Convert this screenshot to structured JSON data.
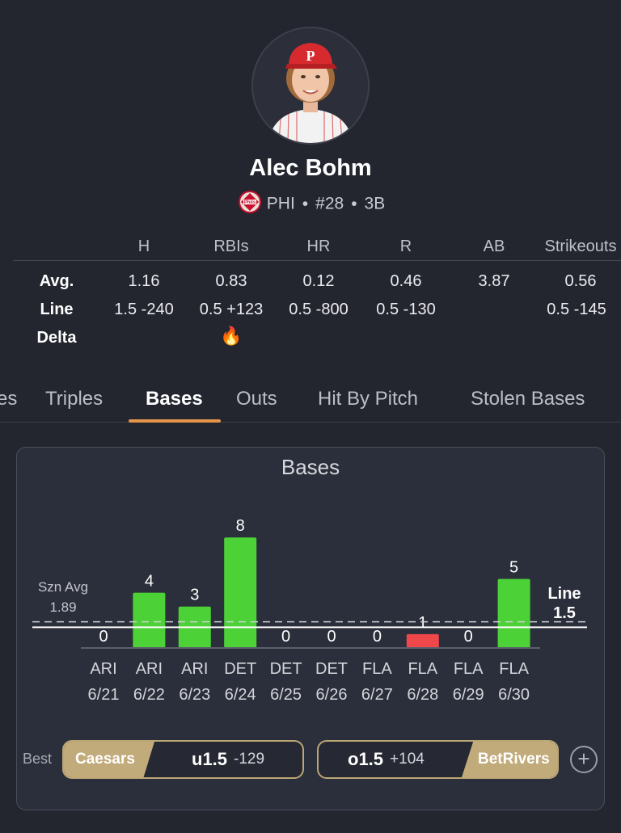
{
  "player": {
    "name": "Alec Bohm",
    "team": "PHI",
    "number": "#28",
    "position": "3B",
    "sep": "•"
  },
  "stats": {
    "columns": [
      "H",
      "RBIs",
      "HR",
      "R",
      "AB",
      "Strikeouts"
    ],
    "row_labels": {
      "avg": "Avg.",
      "line": "Line",
      "delta": "Delta"
    },
    "avg": [
      "1.16",
      "0.83",
      "0.12",
      "0.46",
      "3.87",
      "0.56"
    ],
    "line": [
      "1.5 -240",
      "0.5 +123",
      "0.5 -800",
      "0.5 -130",
      "",
      "0.5 -145"
    ],
    "delta_fire_col": 1,
    "fire": "🔥"
  },
  "tabs": {
    "items": [
      "es",
      "Triples",
      "Bases",
      "Outs",
      "Hit By Pitch",
      "Stolen Bases"
    ],
    "active": "Bases"
  },
  "chart_data": {
    "type": "bar",
    "title": "Bases",
    "categories": [
      "ARI",
      "ARI",
      "ARI",
      "DET",
      "DET",
      "DET",
      "FLA",
      "FLA",
      "FLA",
      "FLA"
    ],
    "dates": [
      "6/21",
      "6/22",
      "6/23",
      "6/24",
      "6/25",
      "6/26",
      "6/27",
      "6/28",
      "6/29",
      "6/30"
    ],
    "values": [
      0,
      4,
      3,
      8,
      0,
      0,
      0,
      1,
      0,
      5
    ],
    "line": 1.5,
    "season_avg": 1.89,
    "season_avg_label": "Szn Avg",
    "season_avg_text": "1.89",
    "line_label": "Line",
    "line_value_text": "1.5",
    "colors": {
      "over": "#4cd137",
      "under": "#f0474a",
      "line": "#ffffff",
      "avg": "#d0d0d6"
    }
  },
  "odds": {
    "best_label": "Best",
    "under": {
      "book": "Caesars",
      "line": "u1.5",
      "price": "-129"
    },
    "over": {
      "book": "BetRivers",
      "line": "o1.5",
      "price": "+104"
    },
    "add_icon": "plus-circle-icon"
  }
}
